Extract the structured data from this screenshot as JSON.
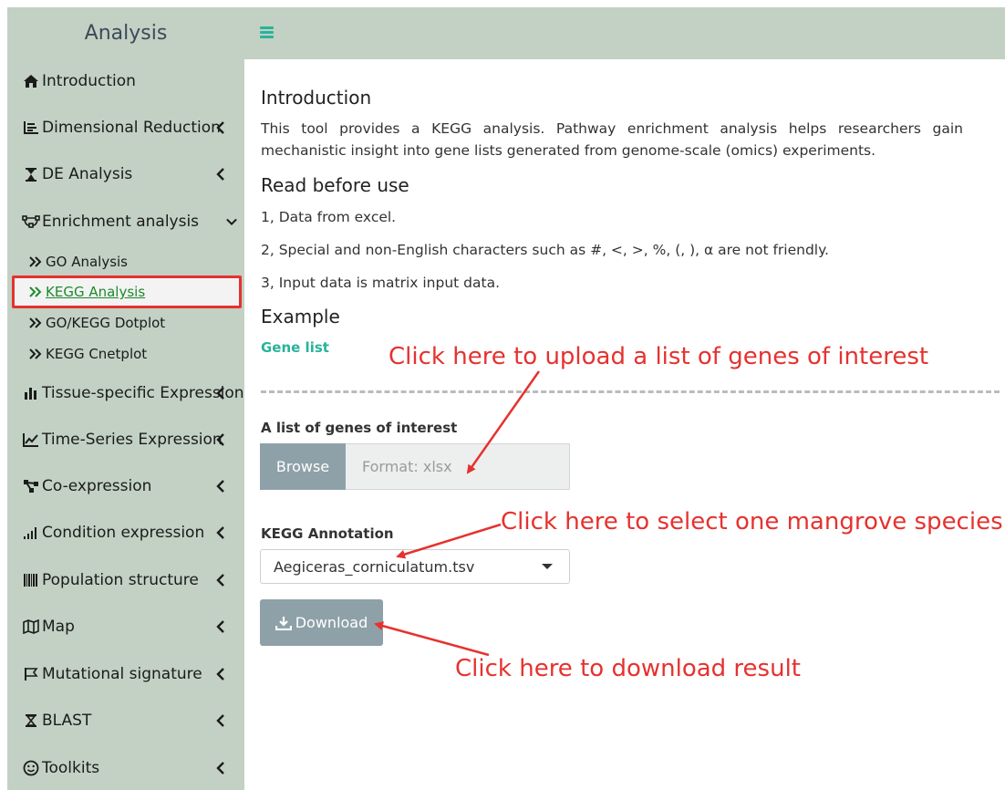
{
  "brand": {
    "title": "Analysis"
  },
  "sidebar": {
    "items": [
      {
        "label": "Introduction",
        "icon": "home-icon"
      },
      {
        "label": "Dimensional Reduction",
        "icon": "list-icon"
      },
      {
        "label": "DE Analysis",
        "icon": "flask-icon"
      },
      {
        "label": "Enrichment analysis",
        "icon": "bezier-icon"
      },
      {
        "label": "Tissue-specific Expression",
        "icon": "bar-chart-icon"
      },
      {
        "label": "Time-Series Expression",
        "icon": "line-chart-icon"
      },
      {
        "label": "Co-expression",
        "icon": "network-icon"
      },
      {
        "label": "Condition expression",
        "icon": "signal-icon"
      },
      {
        "label": "Population structure",
        "icon": "barcode-icon"
      },
      {
        "label": "Map",
        "icon": "map-icon"
      },
      {
        "label": "Mutational signature",
        "icon": "flag-icon"
      },
      {
        "label": "BLAST",
        "icon": "hourglass-icon"
      },
      {
        "label": "Toolkits",
        "icon": "smile-icon"
      }
    ],
    "sub_items": [
      {
        "label": "GO Analysis"
      },
      {
        "label": "KEGG Analysis"
      },
      {
        "label": "GO/KEGG Dotplot"
      },
      {
        "label": "KEGG Cnetplot"
      }
    ]
  },
  "main": {
    "intro_title": "Introduction",
    "intro_text": "This tool provides a KEGG analysis. Pathway enrichment analysis helps researchers gain mechanistic insight into gene lists generated from genome-scale (omics) experiments.",
    "read_title": "Read before use",
    "notes": [
      "1, Data from excel.",
      "2, Special and non-English characters such as #, <, >, %, (, ), α are not friendly.",
      "3, Input data is matrix input data."
    ],
    "example_title": "Example",
    "gene_list_link": "Gene list",
    "upload": {
      "label": "A list of genes of interest",
      "button": "Browse",
      "placeholder": "Format: xlsx"
    },
    "annotation": {
      "label": "KEGG Annotation",
      "selected": "Aegiceras_corniculatum.tsv"
    },
    "download_label": "Download"
  },
  "annotations": {
    "upload_hint": "Click here to upload a list of genes of interest",
    "species_hint": "Click here to select one mangrove species",
    "download_hint": "Click here to download result"
  },
  "colors": {
    "sidebar_bg": "#c2d1c3",
    "accent": "#2ab39a",
    "button_bg": "#8ea1a8",
    "annotation_red": "#e5322f",
    "active_link": "#1e8a2d"
  }
}
